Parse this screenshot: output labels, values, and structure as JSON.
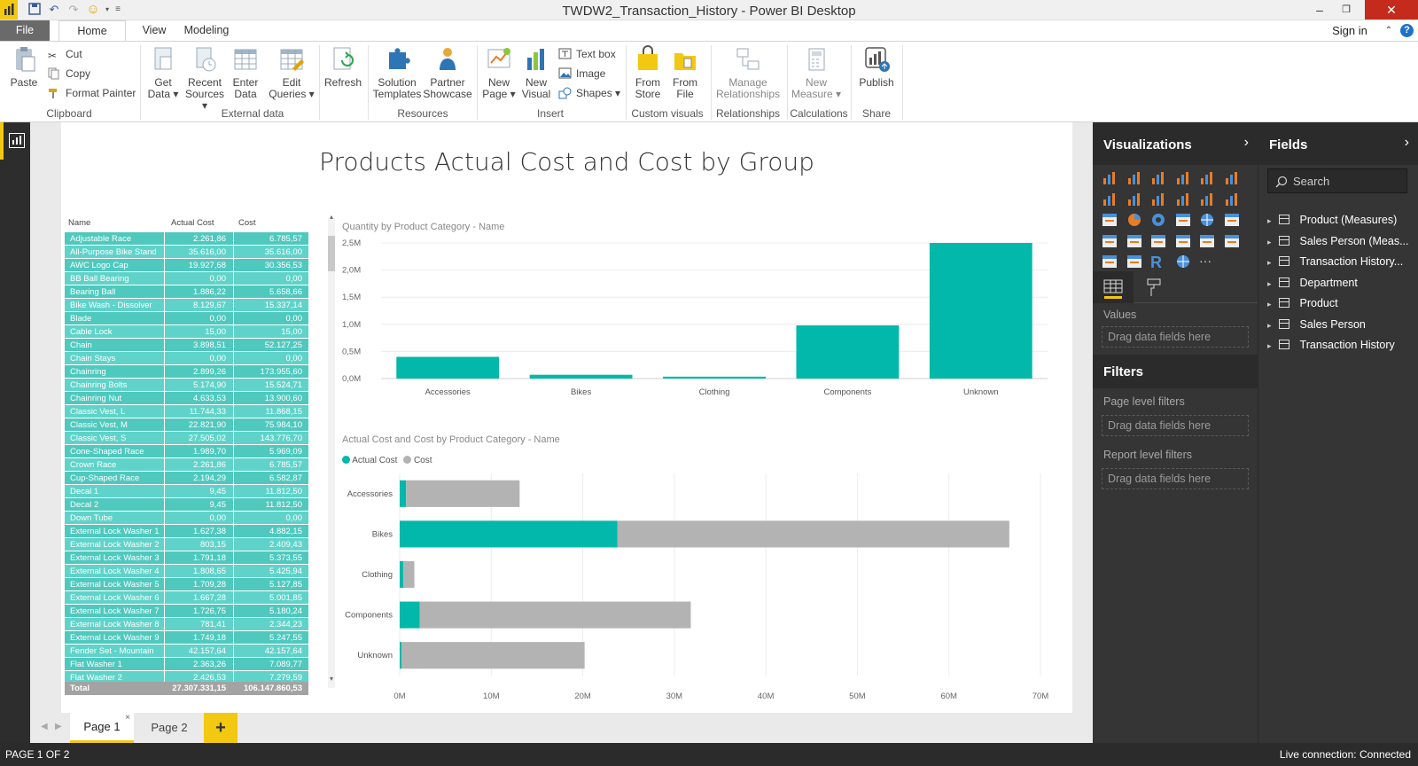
{
  "window": {
    "title": "TWDW2_Transaction_History - Power BI Desktop"
  },
  "menu": {
    "file": "File",
    "home": "Home",
    "view": "View",
    "modeling": "Modeling",
    "sign_in": "Sign in"
  },
  "ribbon": {
    "paste": "Paste",
    "cut": "Cut",
    "copy": "Copy",
    "format_painter": "Format Painter",
    "get_data": [
      "Get",
      "Data"
    ],
    "recent_sources": [
      "Recent",
      "Sources"
    ],
    "enter_data": [
      "Enter",
      "Data"
    ],
    "edit_queries": [
      "Edit",
      "Queries"
    ],
    "refresh": "Refresh",
    "solution_templates": [
      "Solution",
      "Templates"
    ],
    "partner_showcase": [
      "Partner",
      "Showcase"
    ],
    "new_page": [
      "New",
      "Page"
    ],
    "new_visual": [
      "New",
      "Visual"
    ],
    "text_box": "Text box",
    "image": "Image",
    "shapes": "Shapes",
    "from_store": [
      "From",
      "Store"
    ],
    "from_file": [
      "From",
      "File"
    ],
    "manage_relationships": [
      "Manage",
      "Relationships"
    ],
    "new_measure": [
      "New",
      "Measure"
    ],
    "publish": "Publish",
    "groups": {
      "clipboard": "Clipboard",
      "external_data": "External data",
      "resources": "Resources",
      "insert": "Insert",
      "custom_visuals": "Custom visuals",
      "relationships": "Relationships",
      "calculations": "Calculations",
      "share": "Share"
    }
  },
  "report": {
    "title": "Products Actual Cost and Cost by Group",
    "table": {
      "columns": [
        "Name",
        "Actual Cost",
        "Cost"
      ],
      "rows": [
        [
          "Adjustable Race",
          "2.261,86",
          "6.785,57"
        ],
        [
          "All-Purpose Bike Stand",
          "35.616,00",
          "35.616,00"
        ],
        [
          "AWC Logo Cap",
          "19.927,68",
          "30.356,53"
        ],
        [
          "BB Ball Bearing",
          "0,00",
          "0,00"
        ],
        [
          "Bearing Ball",
          "1.886,22",
          "5.658,66"
        ],
        [
          "Bike Wash - Dissolver",
          "8.129,67",
          "15.337,14"
        ],
        [
          "Blade",
          "0,00",
          "0,00"
        ],
        [
          "Cable Lock",
          "15,00",
          "15,00"
        ],
        [
          "Chain",
          "3.898,51",
          "52.127,25"
        ],
        [
          "Chain Stays",
          "0,00",
          "0,00"
        ],
        [
          "Chainring",
          "2.899,26",
          "173.955,60"
        ],
        [
          "Chainring Bolts",
          "5.174,90",
          "15.524,71"
        ],
        [
          "Chainring Nut",
          "4.633,53",
          "13.900,60"
        ],
        [
          "Classic Vest, L",
          "11.744,33",
          "11.868,15"
        ],
        [
          "Classic Vest, M",
          "22.821,90",
          "75.984,10"
        ],
        [
          "Classic Vest, S",
          "27.505,02",
          "143.776,70"
        ],
        [
          "Cone-Shaped Race",
          "1.989,70",
          "5.969,09"
        ],
        [
          "Crown Race",
          "2.261,86",
          "6.785,57"
        ],
        [
          "Cup-Shaped Race",
          "2.194,29",
          "6.582,87"
        ],
        [
          "Decal 1",
          "9,45",
          "11.812,50"
        ],
        [
          "Decal 2",
          "9,45",
          "11.812,50"
        ],
        [
          "Down Tube",
          "0,00",
          "0,00"
        ],
        [
          "External Lock Washer 1",
          "1.627,38",
          "4.882,15"
        ],
        [
          "External Lock Washer 2",
          "803,15",
          "2.409,43"
        ],
        [
          "External Lock Washer 3",
          "1.791,18",
          "5.373,55"
        ],
        [
          "External Lock Washer 4",
          "1.808,65",
          "5.425,94"
        ],
        [
          "External Lock Washer 5",
          "1.709,28",
          "5.127,85"
        ],
        [
          "External Lock Washer 6",
          "1.667,28",
          "5.001,85"
        ],
        [
          "External Lock Washer 7",
          "1.726,75",
          "5.180,24"
        ],
        [
          "External Lock Washer 8",
          "781,41",
          "2.344,23"
        ],
        [
          "External Lock Washer 9",
          "1.749,18",
          "5.247,55"
        ],
        [
          "Fender Set - Mountain",
          "42.157,64",
          "42.157,64"
        ],
        [
          "Flat Washer 1",
          "2.363,26",
          "7.089,77"
        ],
        [
          "Flat Washer 2",
          "2.426,53",
          "7.279,59"
        ]
      ],
      "total": [
        "Total",
        "27.307.331,15",
        "106.147.860,53"
      ]
    },
    "charts": [
      {
        "type": "bar",
        "title": "Quantity by Product Category - Name",
        "categories": [
          "Accessories",
          "Bikes",
          "Clothing",
          "Components",
          "Unknown"
        ],
        "values": [
          400000,
          70000,
          35000,
          980000,
          2500000
        ],
        "ylim": [
          0,
          2500000
        ],
        "yticks": [
          "0,0M",
          "0,5M",
          "1,0M",
          "1,5M",
          "2,0M",
          "2,5M"
        ],
        "grid": true,
        "color": "#01b8aa"
      },
      {
        "type": "bar",
        "orientation": "horizontal",
        "stacked": true,
        "title": "Actual Cost and Cost by Product Category - Name",
        "categories": [
          "Accessories",
          "Bikes",
          "Clothing",
          "Components",
          "Unknown"
        ],
        "series": [
          {
            "name": "Actual Cost",
            "values": [
              700000,
              23800000,
              400000,
              2200000,
              200000
            ],
            "color": "#01b8aa"
          },
          {
            "name": "Cost",
            "values": [
              12400000,
              42800000,
              1200000,
              29600000,
              20000000
            ],
            "color": "#b3b3b3"
          }
        ],
        "xlim": [
          0,
          70000000
        ],
        "xticks": [
          "0M",
          "10M",
          "20M",
          "30M",
          "40M",
          "50M",
          "60M",
          "70M"
        ],
        "legend": "top-left",
        "grid": true
      }
    ]
  },
  "pages": {
    "tabs": [
      "Page 1",
      "Page 2"
    ],
    "add": "+"
  },
  "visualizations": {
    "header": "Visualizations",
    "values_label": "Values",
    "drag_here": "Drag data fields here",
    "filters": "Filters",
    "page_filters": "Page level filters",
    "report_filters": "Report level filters"
  },
  "fields": {
    "header": "Fields",
    "search_placeholder": "Search",
    "items": [
      "Product (Measures)",
      "Sales Person (Meas...",
      "Transaction History...",
      "Department",
      "Product",
      "Sales Person",
      "Transaction History"
    ]
  },
  "status": {
    "page": "PAGE 1 OF 2",
    "connection": "Live connection: Connected"
  },
  "colors": {
    "accent": "#f2c811",
    "teal": "#01b8aa",
    "grey_bar": "#b3b3b3",
    "table_row": "#5fd3c9"
  }
}
